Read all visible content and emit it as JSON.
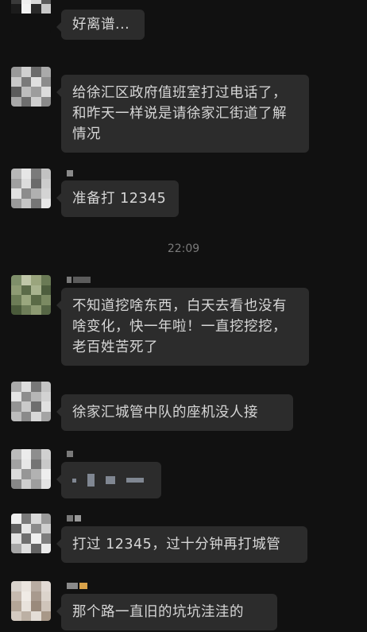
{
  "messages": [
    {
      "id": "m1",
      "text": "好离谱..."
    },
    {
      "id": "m2",
      "text": "给徐汇区政府值班室打过电话了，和昨天一样说是请徐家汇街道了解情况"
    },
    {
      "id": "m3",
      "text": "准备打 12345"
    },
    {
      "id": "m4",
      "text": "不知道挖啥东西，白天去看也没有啥变化，快一年啦！一直挖挖挖，老百姓苦死了"
    },
    {
      "id": "m5",
      "text": "徐家汇城管中队的座机没人接"
    },
    {
      "id": "m6",
      "text": ""
    },
    {
      "id": "m7",
      "text": "打过 12345，过十分钟再打城管"
    },
    {
      "id": "m8",
      "text": "那个路一直旧的坑坑洼洼的"
    }
  ],
  "timestamp": "22:09",
  "colors": {
    "background": "#111111",
    "bubble": "#2c2c2c",
    "text": "#d6d6d6",
    "timestamp": "#7a7a7a"
  }
}
